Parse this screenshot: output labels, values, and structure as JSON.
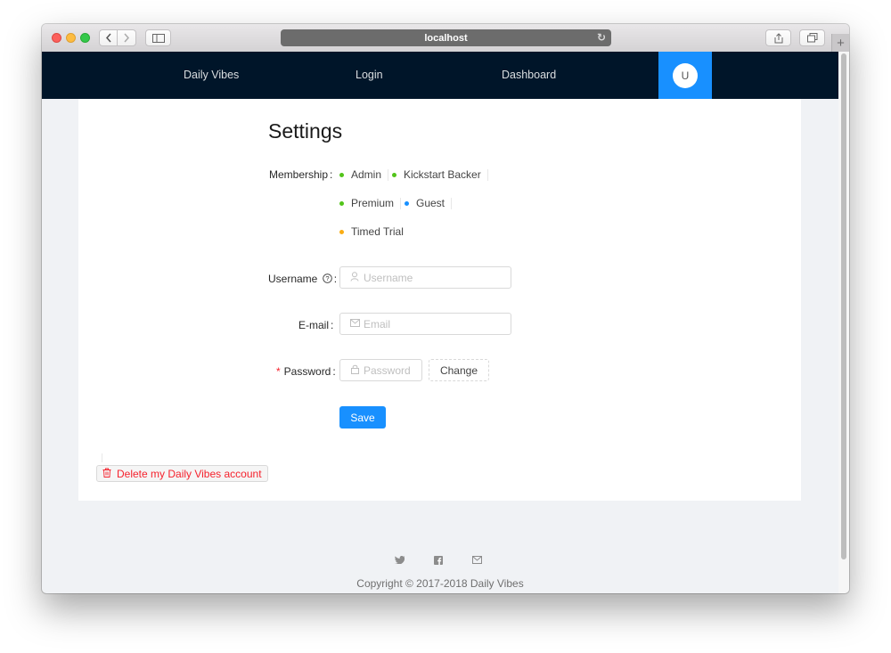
{
  "browser": {
    "url": "localhost",
    "back_icon": "chevron-left-icon",
    "forward_icon": "chevron-right-icon",
    "sidebar_icon": "sidebar-icon",
    "reload_icon": "reload-icon",
    "share_icon": "share-icon",
    "tabs_icon": "tabs-icon",
    "new_tab_icon": "plus-icon"
  },
  "nav": {
    "brand": "Daily Vibes",
    "login": "Login",
    "dashboard": "Dashboard",
    "avatar_letter": "U",
    "active_color": "#1890ff",
    "bar_color": "#001529"
  },
  "settings": {
    "title": "Settings",
    "membership_label": "Membership",
    "memberships": [
      {
        "label": "Admin",
        "color": "#52c41a"
      },
      {
        "label": "Kickstart Backer",
        "color": "#52c41a"
      },
      {
        "label": "Premium",
        "color": "#52c41a"
      },
      {
        "label": "Guest",
        "color": "#1890ff"
      },
      {
        "label": "Timed Trial",
        "color": "#faad14"
      }
    ],
    "username_label": "Username",
    "username_placeholder": "Username",
    "email_label": "E-mail",
    "email_placeholder": "Email",
    "password_label": "Password",
    "password_placeholder": "Password",
    "change_label": "Change",
    "save_label": "Save",
    "delete_label": "Delete my Daily Vibes account"
  },
  "footer": {
    "icons": [
      "twitter-icon",
      "facebook-icon",
      "mail-icon"
    ],
    "copyright": "Copyright © 2017-2018 Daily Vibes"
  }
}
